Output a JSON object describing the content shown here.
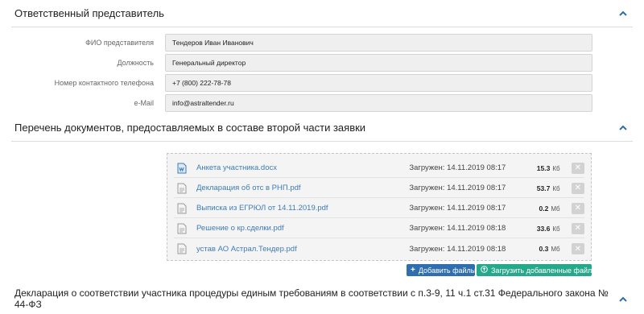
{
  "representative": {
    "title": "Ответственный представитель",
    "fields": [
      {
        "label": "ФИО представителя",
        "value": "Тендеров Иван Иванович"
      },
      {
        "label": "Должность",
        "value": "Генеральный директор"
      },
      {
        "label": "Номер контактного телефона",
        "value": "+7 (800) 222-78-78"
      },
      {
        "label": "e-Mail",
        "value": "info@astraltender.ru"
      }
    ]
  },
  "documents": {
    "title": "Перечень документов, предоставляемых в составе второй части заявки",
    "items": [
      {
        "name": "Анкета участника.docx",
        "uploaded": "Загружен: 14.11.2019 08:17",
        "size": "15.3",
        "unit": "Кб",
        "icon": "word-file-icon"
      },
      {
        "name": "Декларация об отс в РНП.pdf",
        "uploaded": "Загружен: 14.11.2019 08:17",
        "size": "53.7",
        "unit": "Кб",
        "icon": "file-icon"
      },
      {
        "name": "Выписка из ЕГРЮЛ от 14.11.2019.pdf",
        "uploaded": "Загружен: 14.11.2019 08:17",
        "size": "0.2",
        "unit": "Мб",
        "icon": "file-icon"
      },
      {
        "name": "Решение о кр.сделки.pdf",
        "uploaded": "Загружен: 14.11.2019 08:18",
        "size": "33.6",
        "unit": "Кб",
        "icon": "file-icon"
      },
      {
        "name": "устав АО Астрал.Тендер.pdf",
        "uploaded": "Загружен: 14.11.2019 08:18",
        "size": "0.3",
        "unit": "Мб",
        "icon": "file-icon"
      }
    ],
    "add_button": "Добавить файлы",
    "upload_button": "Загрузить добавленные файлы"
  },
  "declaration": {
    "title": "Декларация о соответствии участника процедуры единым требованиям в соответствии с п.3-9, 11 ч.1 ст.31 Федерального закона № 44-ФЗ"
  },
  "colors": {
    "link": "#3f7bb9",
    "add_button": "#2f6fb0",
    "upload_button": "#26a88b",
    "chevron": "#2f6fb0"
  }
}
